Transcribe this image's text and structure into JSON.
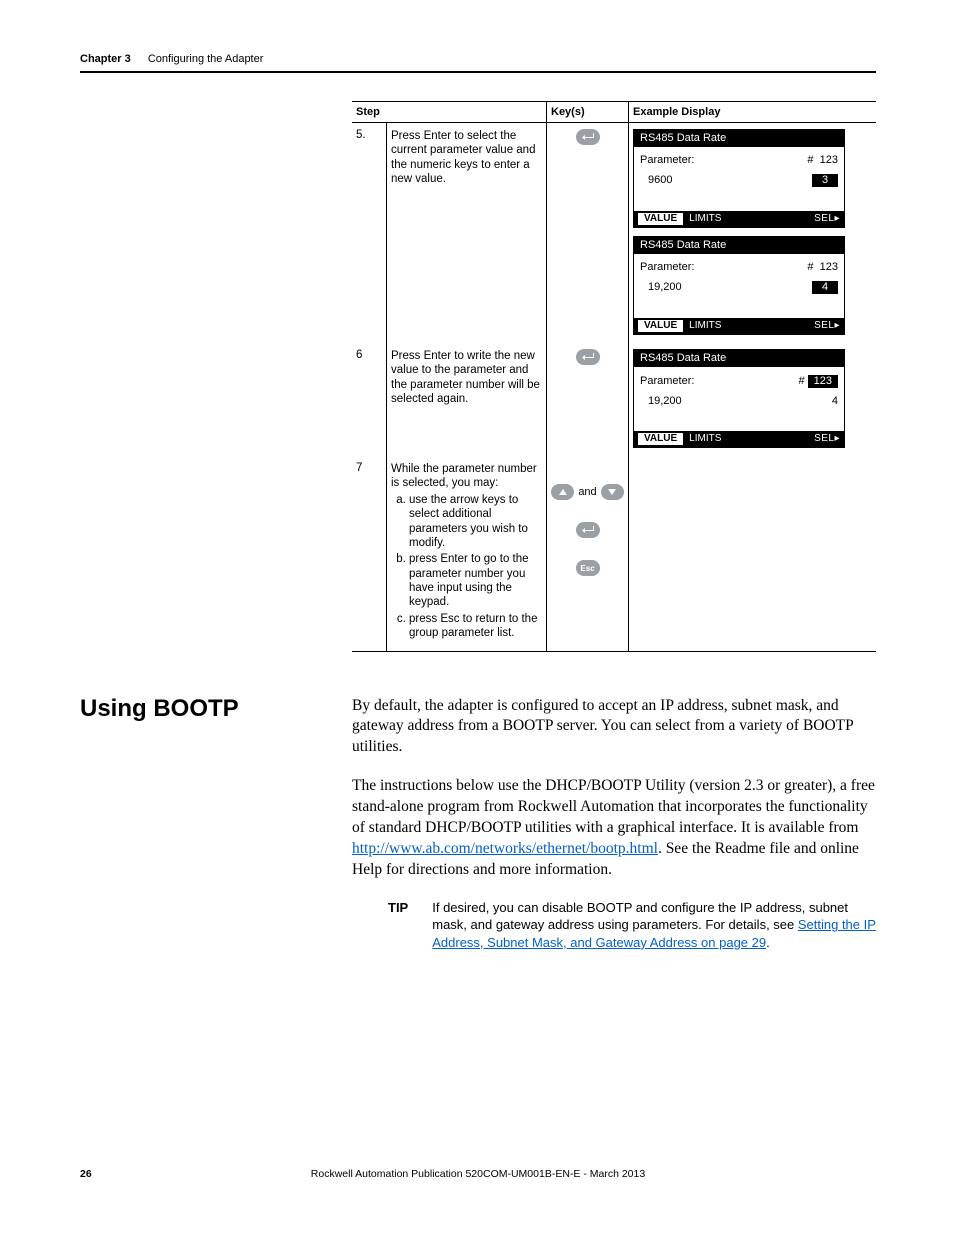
{
  "header": {
    "chapter": "Chapter 3",
    "title": "Configuring the Adapter"
  },
  "table": {
    "headers": {
      "step": "Step",
      "keys": "Key(s)",
      "display": "Example Display"
    },
    "rows": [
      {
        "num": "5.",
        "text": "Press Enter to select the current parameter value and the numeric keys to enter a new value.",
        "keys": [
          {
            "type": "enter"
          }
        ],
        "displays": [
          "d1",
          "d2"
        ]
      },
      {
        "num": "6",
        "text": "Press Enter to write the new value to the parameter and the parameter number will be selected again.",
        "keys": [
          {
            "type": "enter"
          }
        ],
        "displays": [
          "d3"
        ]
      },
      {
        "num": "7",
        "text": "While the parameter number is selected, you may:",
        "sub": [
          "use the arrow keys to select additional parameters you wish to modify.",
          "press Enter to go to the parameter number you have input using the keypad.",
          "press Esc to return to the group parameter list."
        ],
        "keys": [
          {
            "type": "updown",
            "sep": "and"
          },
          {
            "type": "enter"
          },
          {
            "type": "esc",
            "label": "Esc"
          }
        ],
        "displays": []
      }
    ]
  },
  "lcd_common": {
    "title": "RS485 Data Rate",
    "param_label": "Parameter:",
    "param_num_prefix": "#",
    "param_num": "123",
    "tabs": {
      "value": "VALUE",
      "limits": "LIMITS",
      "sel": "SEL"
    }
  },
  "lcd": {
    "d1": {
      "value": "9600",
      "digit": "3",
      "digit_hl": true,
      "paramnum_hl": false
    },
    "d2": {
      "value": "19,200",
      "digit": "4",
      "digit_hl": true,
      "paramnum_hl": false
    },
    "d3": {
      "value": "19,200",
      "digit": "4",
      "digit_hl": false,
      "paramnum_hl": true
    }
  },
  "section": {
    "heading": "Using BOOTP",
    "p1": "By default, the adapter is configured to accept an IP address, subnet mask, and gateway address from a BOOTP server. You can select from a variety of BOOTP utilities.",
    "p2a": "The instructions below use the DHCP/BOOTP Utility (version 2.3 or greater), a free stand-alone program from Rockwell Automation that incorporates the functionality of standard DHCP/BOOTP utilities with a graphical interface. It is available from ",
    "p2link": "http://www.ab.com/networks/ethernet/bootp.html",
    "p2b": ". See the Readme file and online Help for directions and more information.",
    "tip_label": "TIP",
    "tip_a": "If desired, you can disable BOOTP and configure the IP address, subnet mask, and gateway address using parameters. For details, see ",
    "tip_link": "Setting the IP Address, Subnet Mask, and Gateway Address on page 29",
    "tip_b": "."
  },
  "footer": {
    "page": "26",
    "pub": "Rockwell Automation Publication 520COM-UM001B-EN-E - March 2013"
  }
}
